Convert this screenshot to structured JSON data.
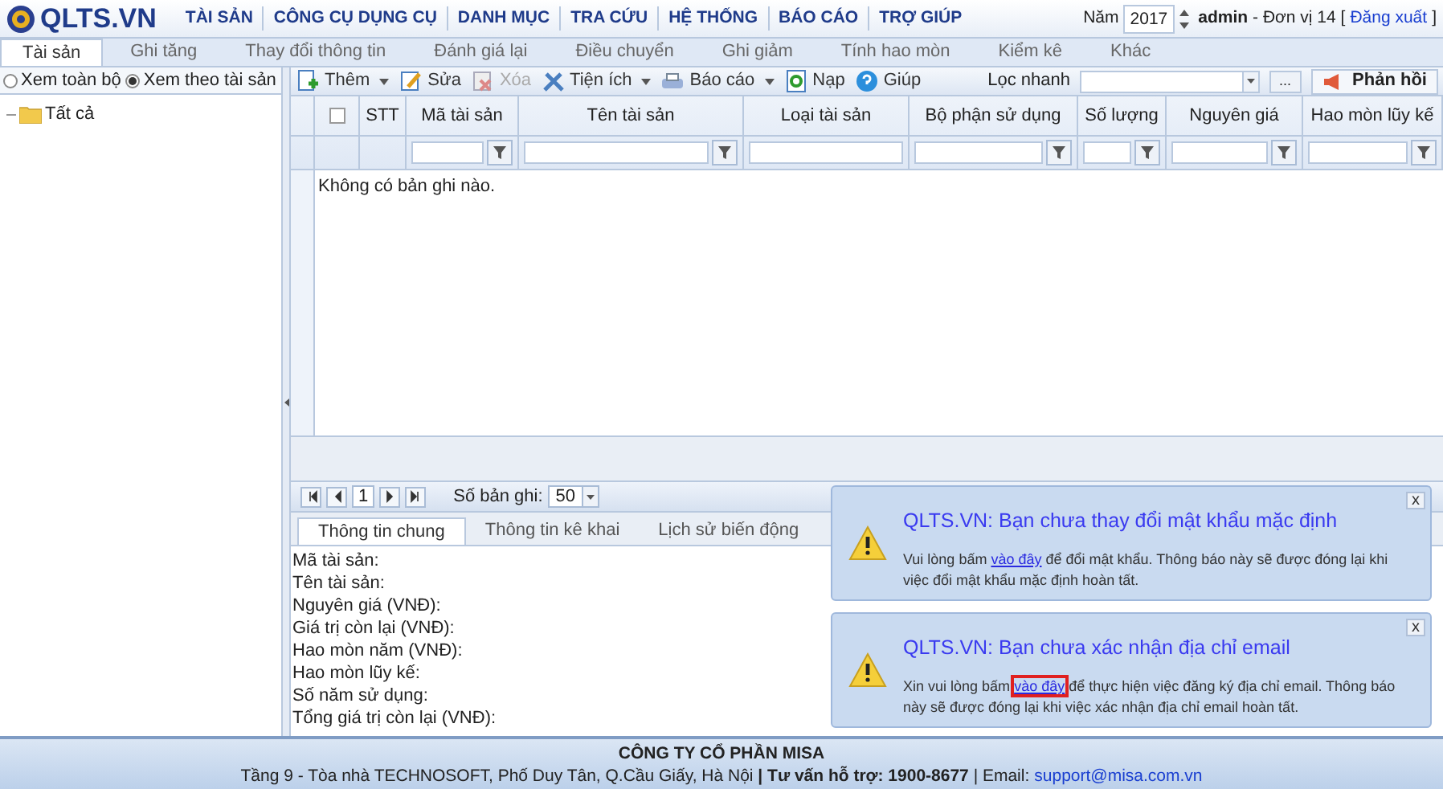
{
  "logo": "QLTS.VN",
  "menu": [
    "TÀI SẢN",
    "CÔNG CỤ DỤNG CỤ",
    "DANH MỤC",
    "TRA CỨU",
    "HỆ THỐNG",
    "BÁO CÁO",
    "TRỢ GIÚP"
  ],
  "user_bar": {
    "year_label": "Năm",
    "year": "2017",
    "user": "admin",
    "unit": "- Đơn vị 14 [",
    "logout": "Đăng xuất",
    "close_bracket": "]"
  },
  "tabs": [
    {
      "label": "Tài sản",
      "selected": true
    },
    {
      "label": "Ghi tăng",
      "selected": false
    },
    {
      "label": "Thay đổi thông tin",
      "selected": false
    },
    {
      "label": "Đánh giá lại",
      "selected": false
    },
    {
      "label": "Điều chuyển",
      "selected": false
    },
    {
      "label": "Ghi giảm",
      "selected": false
    },
    {
      "label": "Tính hao mòn",
      "selected": false
    },
    {
      "label": "Kiểm kê",
      "selected": false
    },
    {
      "label": "Khác",
      "selected": false
    }
  ],
  "view_options": [
    {
      "label": "Xem toàn bộ",
      "selected": false
    },
    {
      "label": "Xem theo tài sản",
      "selected": true
    }
  ],
  "tree": [
    {
      "label": "Tất cả"
    }
  ],
  "toolbar": [
    {
      "label": "Thêm",
      "kind": "add",
      "menu": true,
      "disabled": false
    },
    {
      "label": "Sửa",
      "kind": "edit",
      "menu": false,
      "disabled": false
    },
    {
      "label": "Xóa",
      "kind": "delete",
      "menu": false,
      "disabled": true
    },
    {
      "label": "Tiện ích",
      "kind": "tools",
      "menu": true,
      "disabled": false
    },
    {
      "label": "Báo cáo",
      "kind": "report",
      "menu": true,
      "disabled": false
    },
    {
      "label": "Nạp",
      "kind": "reload",
      "menu": false,
      "disabled": false
    },
    {
      "label": "Giúp",
      "kind": "help",
      "menu": false,
      "disabled": false
    }
  ],
  "quick_filter": {
    "label": "Lọc nhanh",
    "more": "...",
    "feedback": "Phản hồi"
  },
  "table": {
    "select_all_checked": false,
    "columns": [
      {
        "label": "STT",
        "filter": false
      },
      {
        "label": "Mã tài sản",
        "filter": true
      },
      {
        "label": "Tên tài sản",
        "filter": true
      },
      {
        "label": "Loại tài sản",
        "filter": false
      },
      {
        "label": "Bộ phận sử dụng",
        "filter": true
      },
      {
        "label": "Số lượng",
        "filter": true
      },
      {
        "label": "Nguyên giá",
        "filter": true
      },
      {
        "label": "Hao mòn lũy kế",
        "filter": true
      }
    ],
    "empty": "Không có bản ghi nào."
  },
  "pager": {
    "page": "1",
    "size_label": "Số bản ghi:",
    "size": "50"
  },
  "detail_tabs": [
    {
      "label": "Thông tin chung",
      "selected": true
    },
    {
      "label": "Thông tin kê khai",
      "selected": false
    },
    {
      "label": "Lịch sử biến động",
      "selected": false
    }
  ],
  "detail_fields": [
    "Mã tài sản:",
    "Tên tài sản:",
    "Nguyên giá (VNĐ):",
    "Giá trị còn lại (VNĐ):",
    "Hao mòn năm (VNĐ):",
    "Hao mòn lũy kế:",
    "Số năm sử dụng:",
    "Tổng giá trị còn lại (VNĐ):"
  ],
  "notifications": [
    {
      "title": "QLTS.VN: Bạn chưa thay đổi mật khẩu mặc định",
      "before": "Vui lòng bấm",
      "link": "vào đây",
      "after": "để đổi mật khẩu. Thông báo này sẽ được đóng lại khi việc đổi mật khẩu mặc định hoàn tất.",
      "highlighted": false,
      "close": "x"
    },
    {
      "title": "QLTS.VN: Bạn chưa xác nhận địa chỉ email",
      "before": "Xin vui lòng bấm",
      "link": "vào đây",
      "after": "để thực hiện việc đăng ký địa chỉ email. Thông báo này sẽ được đóng lại khi việc xác nhận địa chỉ email hoàn tất.",
      "highlighted": true,
      "close": "x"
    }
  ],
  "footer": {
    "company": "CÔNG TY CỔ PHẦN MISA",
    "address": "Tầng 9 - Tòa nhà TECHNOSOFT, Phố Duy Tân, Q.Cầu Giấy, Hà Nội **| Tư vấn hỗ trợ: 1900-8677** | Email:",
    "email": "support@misa.com.vn"
  }
}
